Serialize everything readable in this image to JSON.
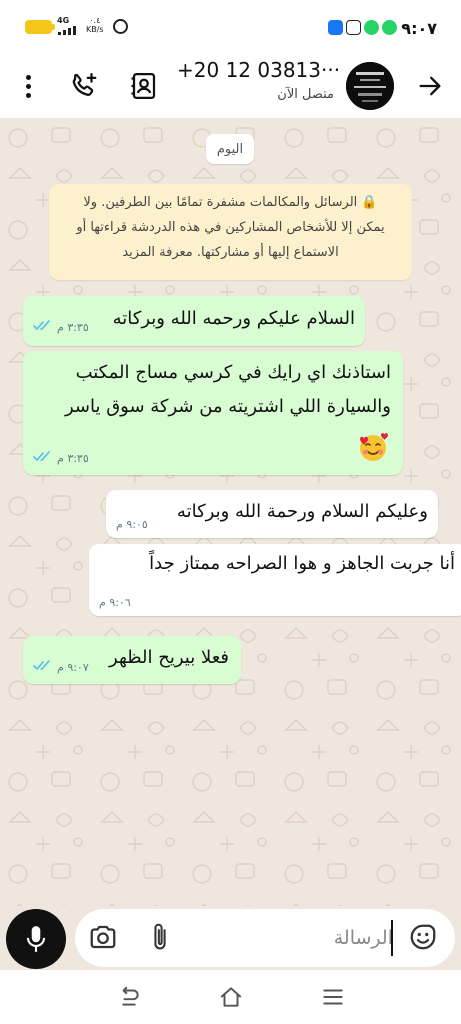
{
  "status_bar": {
    "network": "4G",
    "speed": "٠.٤",
    "speed_unit": "KB/s",
    "time": "٩:٠٧",
    "colors": {
      "battery": "#f5c518",
      "facebook": "#1877f2",
      "whatsapp": "#25d366"
    }
  },
  "header": {
    "title": "+20 12 03813···",
    "status": "متصل الآن",
    "icons": [
      "more-vert-icon",
      "add-call-icon",
      "contact-card-icon",
      "avatar",
      "arrow-back-icon"
    ]
  },
  "chat": {
    "date_chip": "اليوم",
    "encryption_notice": {
      "line1": "الرسائل والمكالمات مشفرة تمامًا بين الطرفين. ولا",
      "line2": "يمكن إلا للأشخاص المشاركين في هذه الدردشة قراءتها أو",
      "line3": "الاستماع إليها أو مشاركتها. معرفة المزيد"
    },
    "messages": [
      {
        "direction": "outgoing",
        "text": "السلام عليكم ورحمه الله وبركاته",
        "time": "٣:٣٥ م",
        "status": "read"
      },
      {
        "direction": "outgoing",
        "lines": [
          "استاذنك اي رايك في كرسي مساج المكتب",
          "والسيارة اللي اشتريته من شركة سوق ياسر"
        ],
        "emoji": "smiling-face-with-hearts",
        "time": "٣:٣٥ م",
        "status": "read"
      },
      {
        "direction": "incoming",
        "text": "وعليكم السلام ورحمة الله وبركاته",
        "time": "٩:٠٥ م"
      },
      {
        "direction": "incoming",
        "text": "أنا جربت الجاهز و هوا الصراحه ممتاز جداً",
        "time": "٩:٠٦ م"
      },
      {
        "direction": "outgoing",
        "text": "فعلا بيريح الظهر",
        "time": "٩:٠٧ م",
        "status": "read"
      }
    ],
    "colors": {
      "outgoing_bubble": "#d9fdd3",
      "incoming_bubble": "#ffffff",
      "read_ticks": "#53bdeb",
      "wallpaper": "#efe7dd"
    }
  },
  "composer": {
    "placeholder": "الرسالة",
    "icons": [
      "mic-icon",
      "camera-icon",
      "attach-icon",
      "sticker-icon"
    ]
  },
  "navbar": {
    "icons": [
      "back-nav-icon",
      "home-nav-icon",
      "recents-nav-icon"
    ]
  }
}
